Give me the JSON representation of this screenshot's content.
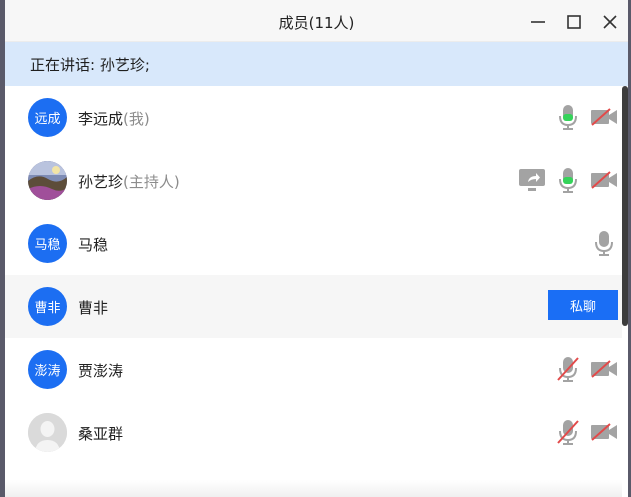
{
  "window": {
    "title": "成员(11人)",
    "minimize_icon": "minimize-icon",
    "maximize_icon": "maximize-icon",
    "close_icon": "close-icon"
  },
  "speaking": {
    "text": "正在讲话: 孙艺珍;"
  },
  "colors": {
    "accent": "#1a6ef5",
    "speaking_bg": "#d8e8fb",
    "mic_active": "#35d35a",
    "muted_red": "#e24a4a",
    "icon_gray": "#a3a3a3"
  },
  "members": [
    {
      "avatar_text": "远成",
      "name": "李远成",
      "suffix": "(我)",
      "mic": "active",
      "video": "off"
    },
    {
      "avatar_text": "",
      "name": "孙艺珍",
      "suffix": "(主持人)",
      "share": true,
      "mic": "active",
      "video": "off"
    },
    {
      "avatar_text": "马稳",
      "name": "马稳",
      "suffix": "",
      "mic": "idle"
    },
    {
      "avatar_text": "曹非",
      "name": "曹非",
      "suffix": "",
      "action_label": "私聊"
    },
    {
      "avatar_text": "澎涛",
      "name": "贾澎涛",
      "suffix": "",
      "mic": "muted",
      "video": "off"
    },
    {
      "avatar_text": "",
      "name": "桑亚群",
      "suffix": "",
      "mic": "muted",
      "video": "off"
    }
  ]
}
